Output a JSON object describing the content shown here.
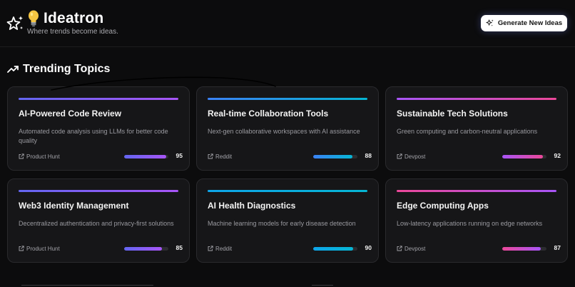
{
  "brand": {
    "name": "Ideatron",
    "tagline": "Where trends become ideas.",
    "logo_icon": "sparkle-stars-icon",
    "bulb_icon": "lightbulb-icon"
  },
  "header": {
    "generate_label": "Generate New Ideas",
    "generate_icon": "sparkles-icon"
  },
  "section": {
    "title": "Trending Topics",
    "icon": "trending-up-icon"
  },
  "colors": {
    "purple": "#8b5cf6",
    "blue": "#0ea5e9",
    "pink": "#ec4899",
    "cyan": "#06b6d4"
  },
  "cards": [
    {
      "title": "AI-Powered Code Review",
      "description": "Automated code analysis using LLMs for better code quality",
      "source": "Product Hunt",
      "score": "95",
      "score_fraction": 0.95,
      "gradient": [
        "#6366f1",
        "#a855f7"
      ]
    },
    {
      "title": "Real-time Collaboration Tools",
      "description": "Next-gen collaborative workspaces with AI assistance",
      "source": "Reddit",
      "score": "88",
      "score_fraction": 0.88,
      "gradient": [
        "#3b82f6",
        "#06b6d4"
      ]
    },
    {
      "title": "Sustainable Tech Solutions",
      "description": "Green computing and carbon-neutral applications",
      "source": "Devpost",
      "score": "92",
      "score_fraction": 0.92,
      "gradient": [
        "#a855f7",
        "#ec4899"
      ]
    },
    {
      "title": "Web3 Identity Management",
      "description": "Decentralized authentication and privacy-first solutions",
      "source": "Product Hunt",
      "score": "85",
      "score_fraction": 0.85,
      "gradient": [
        "#6366f1",
        "#a855f7"
      ]
    },
    {
      "title": "AI Health Diagnostics",
      "description": "Machine learning models for early disease detection",
      "source": "Reddit",
      "score": "90",
      "score_fraction": 0.9,
      "gradient": [
        "#0ea5e9",
        "#06b6d4"
      ]
    },
    {
      "title": "Edge Computing Apps",
      "description": "Low-latency applications running on edge networks",
      "source": "Devpost",
      "score": "87",
      "score_fraction": 0.87,
      "gradient": [
        "#ec4899",
        "#a855f7"
      ]
    }
  ]
}
